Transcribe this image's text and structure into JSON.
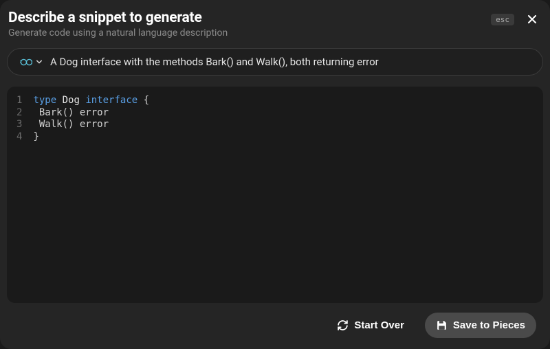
{
  "header": {
    "title": "Describe a snippet to generate",
    "subtitle": "Generate code using a natural language description",
    "esc_label": "esc"
  },
  "input": {
    "language_icon": "go-icon",
    "prompt": "A Dog interface with the methods Bark() and Walk(), both returning error"
  },
  "code": {
    "lines": [
      {
        "n": "1",
        "tokens": [
          {
            "t": "type",
            "c": "keyword"
          },
          {
            "t": " "
          },
          {
            "t": "Dog",
            "c": "type"
          },
          {
            "t": " "
          },
          {
            "t": "interface",
            "c": "keyword"
          },
          {
            "t": " {"
          }
        ]
      },
      {
        "n": "2",
        "tokens": [
          {
            "t": " Bark() error"
          }
        ]
      },
      {
        "n": "3",
        "tokens": [
          {
            "t": " Walk() error"
          }
        ]
      },
      {
        "n": "4",
        "tokens": [
          {
            "t": "}"
          }
        ]
      }
    ]
  },
  "footer": {
    "start_over_label": "Start Over",
    "save_label": "Save to Pieces"
  }
}
